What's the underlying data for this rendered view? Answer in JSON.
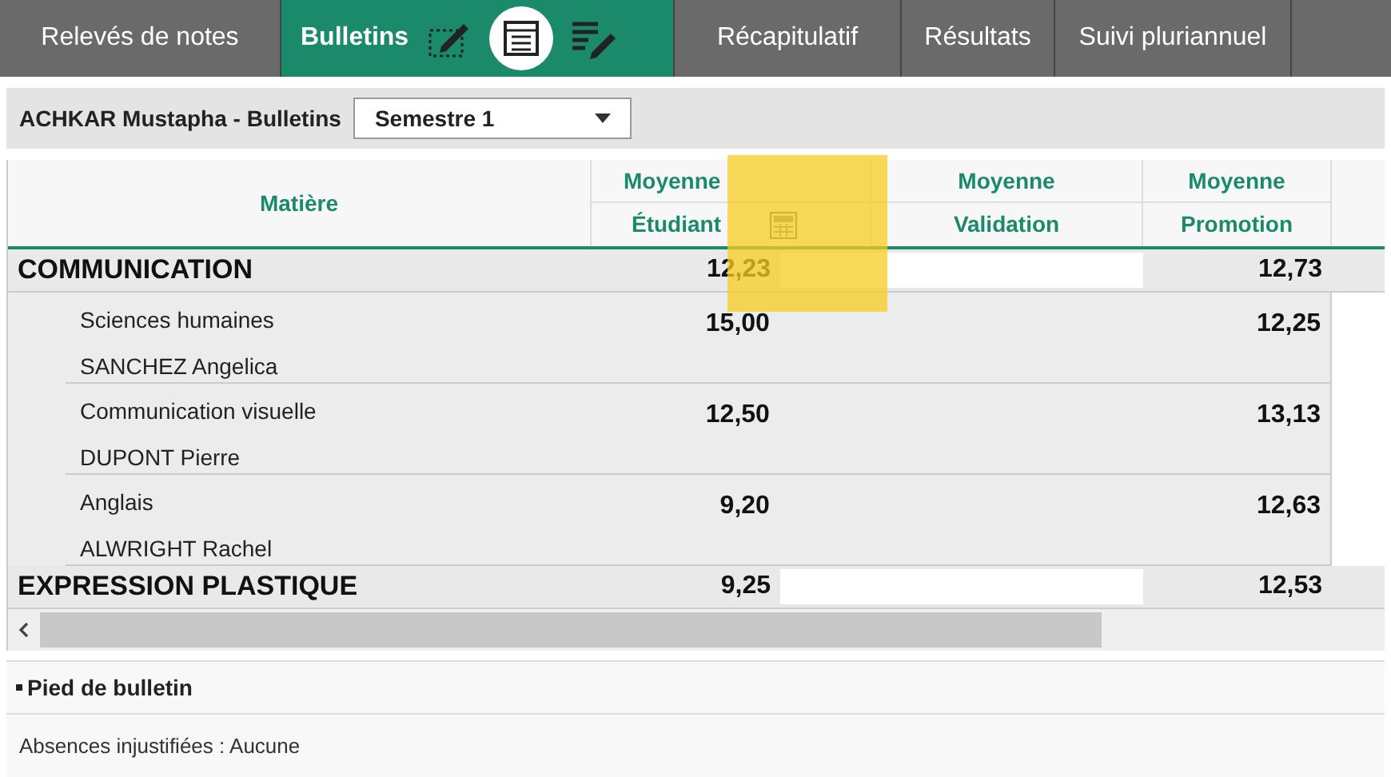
{
  "tabs": [
    {
      "label": "Relevés de notes",
      "selected": false
    },
    {
      "label": "Bulletins",
      "selected": true
    },
    {
      "label": "Récapitulatif",
      "selected": false
    },
    {
      "label": "Résultats",
      "selected": false
    },
    {
      "label": "Suivi pluriannuel",
      "selected": false
    }
  ],
  "toolbar": {
    "title": "ACHKAR Mustapha - Bulletins",
    "period": "Semestre 1"
  },
  "table": {
    "subject_header": "Matière",
    "columns": [
      {
        "top": "Moyenne",
        "bottom": "Étudiant"
      },
      {
        "top": "Moyenne",
        "bottom": "Validation"
      },
      {
        "top": "Moyenne",
        "bottom": "Promotion"
      }
    ],
    "rows": [
      {
        "kind": "group",
        "subject": "COMMUNICATION",
        "student": "12,23",
        "promotion": "12,73"
      },
      {
        "kind": "subject",
        "subject": "Sciences humaines",
        "teacher": "SANCHEZ Angelica",
        "student": "15,00",
        "promotion": "12,25"
      },
      {
        "kind": "subject",
        "subject": "Communication visuelle",
        "teacher": "DUPONT Pierre",
        "student": "12,50",
        "promotion": "13,13"
      },
      {
        "kind": "subject",
        "subject": "Anglais",
        "teacher": "ALWRIGHT Rachel",
        "student": "9,20",
        "promotion": "12,63"
      },
      {
        "kind": "group",
        "subject": "EXPRESSION PLASTIQUE",
        "student": "9,25",
        "promotion": "12,53"
      }
    ]
  },
  "footer": {
    "section": "Pied de bulletin",
    "absences": "Absences injustifiées : Aucune"
  }
}
